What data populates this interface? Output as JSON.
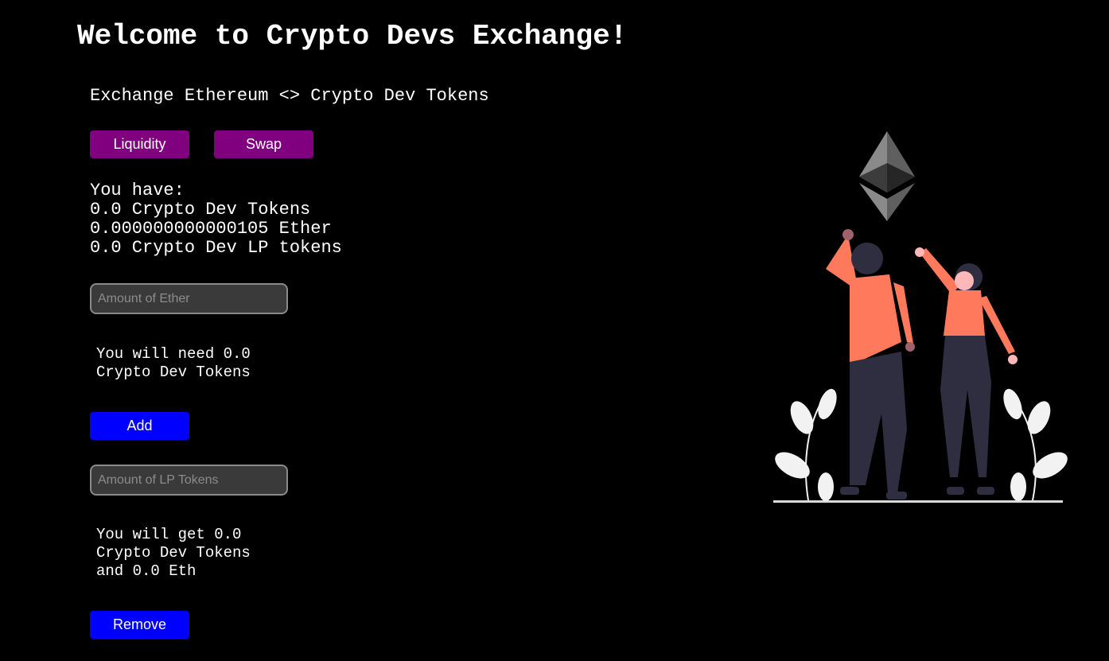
{
  "header": {
    "title": "Welcome to Crypto Devs Exchange!",
    "subtitle": "Exchange Ethereum <> Crypto Dev Tokens"
  },
  "tabs": {
    "liquidity_label": "Liquidity",
    "swap_label": "Swap"
  },
  "balances": {
    "heading": "You have:",
    "crypto_dev_tokens": "0.0 Crypto Dev Tokens",
    "ether": "0.000000000000105 Ether",
    "lp_tokens": "0.0 Crypto Dev LP tokens"
  },
  "add_liquidity": {
    "ether_placeholder": "Amount of Ether",
    "need_line1": "You will need 0.0",
    "need_line2": "Crypto Dev Tokens",
    "add_label": "Add"
  },
  "remove_liquidity": {
    "lp_placeholder": "Amount of LP Tokens",
    "get_line1": "You will get 0.0",
    "get_line2": "Crypto Dev Tokens",
    "get_line3": "and 0.0 Eth",
    "remove_label": "Remove"
  },
  "colors": {
    "background": "#000000",
    "tab_button": "#800080",
    "action_button": "#0000ff",
    "figure_accent": "#ff7a5c",
    "figure_dark": "#2f2e41"
  },
  "illustration": {
    "name": "people-celebrating-ethereum-illustration",
    "icon": "ethereum-logo-icon"
  }
}
